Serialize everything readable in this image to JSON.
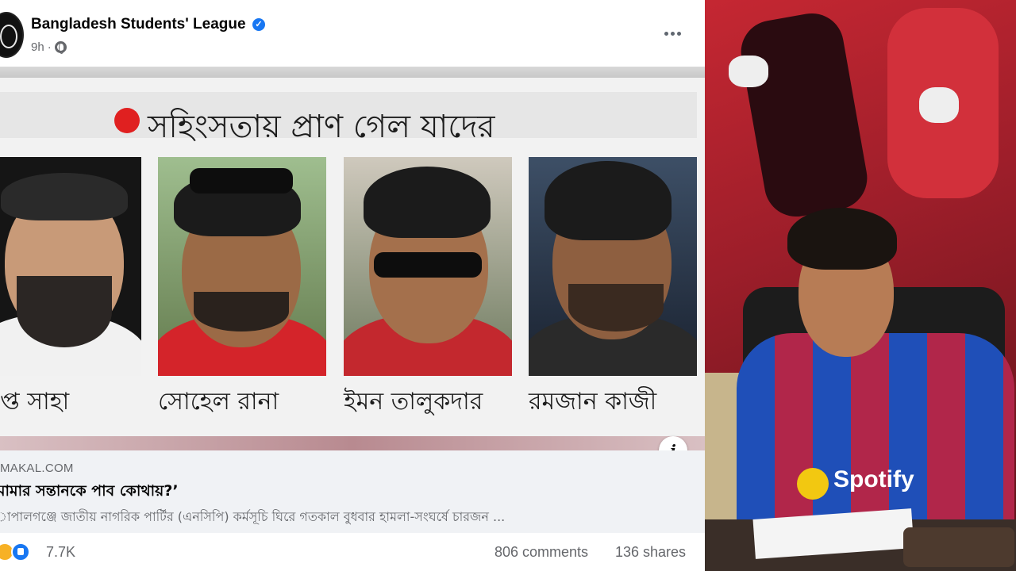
{
  "post": {
    "page_name": "Bangladesh Students' League",
    "verified_mark": "✓",
    "time": "9h",
    "separator": "·",
    "image": {
      "headline": "সহিংসতায় প্রাণ গেল যাদের",
      "captions": [
        "প্ত সাহা",
        "সোহেল রানা",
        "ইমন তালুকদার",
        "রমজান কাজী"
      ],
      "info_symbol": "i"
    },
    "link": {
      "domain": "MAKAL.COM",
      "title": "মামার সন্তানকে পাব কোথায়?’",
      "description": "াপালগঞ্জে জাতীয় নাগরিক পার্টির (এনসিপি) কর্মসূচি ঘিরে গতকাল বুধবার হামলা-সংঘর্ষে চারজন ..."
    },
    "footer": {
      "reaction_count": "7.7K",
      "comments": "806 comments",
      "shares": "136 shares"
    }
  },
  "video": {
    "jersey_text": "Spotify"
  },
  "colors": {
    "verified_blue": "#1877f2",
    "meta_gray": "#65676b",
    "headline_red_dot": "#e02020"
  },
  "icons": [
    "page-avatar",
    "verified-icon",
    "globe-icon",
    "more-options-icon",
    "info-icon",
    "haha-reaction-icon",
    "like-reaction-icon"
  ]
}
